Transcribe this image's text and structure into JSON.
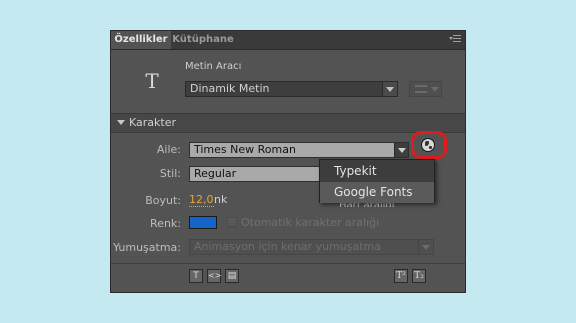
{
  "tabs": [
    {
      "label": "Özellikler"
    },
    {
      "label": "Kütüphane"
    }
  ],
  "tool": {
    "icon_glyph": "T",
    "name": "Metin Aracı",
    "text_type": "Dinamik Metin"
  },
  "section": {
    "title": "Karakter"
  },
  "character": {
    "family_label": "Aile:",
    "family_value": "Times New Roman",
    "style_label": "Stil:",
    "style_value": "Regular",
    "size_label": "Boyut:",
    "size_value": "12,0",
    "size_unit": "nk",
    "hidden_label": "Harf aralığı",
    "color_label": "Renk:",
    "color_value": "#1565c8",
    "autokern_label": "Otomatik karakter aralığı",
    "aa_label": "Yumuşatma:",
    "aa_value": "Animasyon için kenar yumuşatma"
  },
  "font_menu": {
    "items": [
      "Typekit",
      "Google Fonts"
    ],
    "highlighted": "Google Fonts"
  },
  "icons": {
    "globe": "globe-icon",
    "menu": "panel-menu-icon"
  },
  "colors": {
    "highlight_ring": "#e01b1b",
    "size_accent": "#e9a23b"
  }
}
